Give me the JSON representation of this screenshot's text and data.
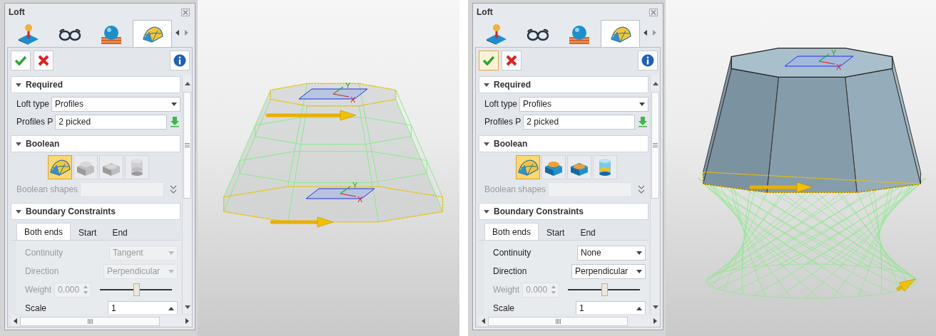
{
  "panels": [
    {
      "title": "Loft",
      "tabs": [
        {
          "kind": "joystick",
          "selected": false
        },
        {
          "kind": "glasses",
          "selected": false
        },
        {
          "kind": "sphere",
          "selected": false
        },
        {
          "kind": "loft",
          "selected": true
        }
      ],
      "actions": [
        {
          "kind": "ok",
          "focused": false
        },
        {
          "kind": "cancel",
          "focused": false
        },
        {
          "kind": "info",
          "focused": false
        }
      ],
      "required": {
        "title": "Required",
        "fields": [
          {
            "kind": "dropdown",
            "label": "Loft type",
            "value": "Profiles"
          },
          {
            "kind": "pick",
            "label": "Profiles P",
            "value": "2 picked"
          }
        ]
      },
      "boolean": {
        "title": "Boolean",
        "buttons": [
          {
            "kind": "base",
            "selected": true,
            "disabled": false
          },
          {
            "kind": "add",
            "selected": false,
            "disabled": true
          },
          {
            "kind": "subtract",
            "selected": false,
            "disabled": true
          },
          {
            "kind": "intersect",
            "selected": false,
            "disabled": true
          }
        ],
        "shapes": {
          "label": "Boolean shapes",
          "disabled": true
        }
      },
      "boundary": {
        "title": "Boundary Constraints",
        "tabs": [
          {
            "label": "Both ends",
            "selected": true
          },
          {
            "label": "Start",
            "selected": false
          },
          {
            "label": "End",
            "selected": false
          }
        ],
        "rows": [
          {
            "kind": "dropdown",
            "label": "Continuity",
            "value": "Tangent",
            "disabled": true
          },
          {
            "kind": "dropdown",
            "label": "Direction",
            "value": "Perpendicular",
            "disabled": true
          },
          {
            "kind": "spin-slider",
            "label": "Weight",
            "value": "0.000",
            "disabled": true,
            "level": 0.5
          },
          {
            "kind": "spin",
            "label": "Scale",
            "value": "1",
            "disabled": false
          }
        ]
      },
      "viewport": {
        "kind": "frustum",
        "planes": [
          {
            "y_label": "Y",
            "x_label": "X"
          },
          {
            "y_label": "Y",
            "x_label": "X"
          }
        ]
      }
    },
    {
      "title": "Loft",
      "tabs": [
        {
          "kind": "joystick",
          "selected": false
        },
        {
          "kind": "glasses",
          "selected": false
        },
        {
          "kind": "sphere",
          "selected": false
        },
        {
          "kind": "loft",
          "selected": true
        }
      ],
      "actions": [
        {
          "kind": "ok",
          "focused": true
        },
        {
          "kind": "cancel",
          "focused": false
        },
        {
          "kind": "info",
          "focused": false
        }
      ],
      "required": {
        "title": "Required",
        "fields": [
          {
            "kind": "dropdown",
            "label": "Loft type",
            "value": "Profiles"
          },
          {
            "kind": "pick",
            "label": "Profiles P",
            "value": "2 picked"
          }
        ]
      },
      "boolean": {
        "title": "Boolean",
        "buttons": [
          {
            "kind": "base",
            "selected": true,
            "disabled": false
          },
          {
            "kind": "add",
            "selected": false,
            "disabled": false
          },
          {
            "kind": "subtract",
            "selected": false,
            "disabled": false
          },
          {
            "kind": "intersect",
            "selected": false,
            "disabled": false
          }
        ],
        "shapes": {
          "label": "Boolean shapes",
          "disabled": true
        }
      },
      "boundary": {
        "title": "Boundary Constraints",
        "tabs": [
          {
            "label": "Both ends",
            "selected": true
          },
          {
            "label": "Start",
            "selected": false
          },
          {
            "label": "End",
            "selected": false
          }
        ],
        "rows": [
          {
            "kind": "dropdown",
            "label": "Continuity",
            "value": "None",
            "disabled": false
          },
          {
            "kind": "dropdown",
            "label": "Direction",
            "value": "Perpendicular",
            "disabled": false
          },
          {
            "kind": "spin-slider",
            "label": "Weight",
            "value": "0.000",
            "disabled": true,
            "level": 0.5
          },
          {
            "kind": "spin",
            "label": "Scale",
            "value": "1",
            "disabled": false
          }
        ]
      },
      "viewport": {
        "kind": "twisted",
        "planes": [
          {
            "y_label": "Y",
            "x_label": "X"
          }
        ]
      }
    }
  ]
}
